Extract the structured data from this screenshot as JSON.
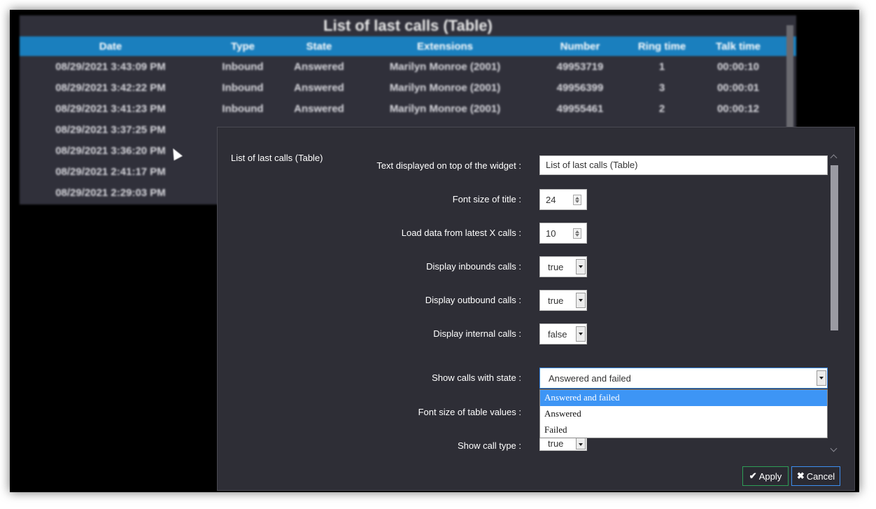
{
  "background_widget": {
    "title": "List of last calls (Table)",
    "columns": [
      "Date",
      "Type",
      "State",
      "Extensions",
      "Number",
      "Ring time",
      "Talk time"
    ],
    "rows": [
      [
        "08/29/2021 3:43:09 PM",
        "Inbound",
        "Answered",
        "Marilyn Monroe (2001)",
        "49953719",
        "1",
        "00:00:10"
      ],
      [
        "08/29/2021 3:42:22 PM",
        "Inbound",
        "Answered",
        "Marilyn Monroe (2001)",
        "49956399",
        "3",
        "00:00:01"
      ],
      [
        "08/29/2021 3:41:23 PM",
        "Inbound",
        "Answered",
        "Marilyn Monroe (2001)",
        "49955461",
        "2",
        "00:00:12"
      ],
      [
        "08/29/2021 3:37:25 PM",
        "",
        "",
        "",
        "",
        "",
        ""
      ],
      [
        "08/29/2021 3:36:20 PM",
        "",
        "",
        "",
        "",
        "",
        ""
      ],
      [
        "08/29/2021 2:41:17 PM",
        "",
        "",
        "",
        "",
        "",
        ""
      ],
      [
        "08/29/2021 2:29:03 PM",
        "",
        "",
        "",
        "",
        "",
        ""
      ]
    ]
  },
  "dialog": {
    "heading": "List of last calls (Table)",
    "fields": {
      "title_text": {
        "label": "Text displayed on top of the widget :",
        "value": "List of last calls (Table)"
      },
      "title_font_size": {
        "label": "Font size of title :",
        "value": "24"
      },
      "latest_calls": {
        "label": "Load data from latest X calls :",
        "value": "10"
      },
      "inbound": {
        "label": "Display inbounds calls :",
        "value": "true"
      },
      "outbound": {
        "label": "Display outbound calls :",
        "value": "true"
      },
      "internal": {
        "label": "Display internal calls :",
        "value": "false"
      },
      "state": {
        "label": "Show calls with state :",
        "value": "Answered and failed"
      },
      "table_font_size": {
        "label": "Font size of table values :"
      },
      "call_type": {
        "label": "Show call type :",
        "value": "true"
      }
    },
    "state_options": [
      "Answered and failed",
      "Answered",
      "Failed"
    ],
    "selected_option_index": 0,
    "apply_label": "Apply",
    "cancel_label": "Cancel",
    "apply_icon": "check-icon",
    "cancel_icon": "x-icon"
  },
  "colors": {
    "header_blue": "#1a7fbe",
    "dialog_bg": "#2e2e36",
    "selected_option": "#3d95f5",
    "apply_border": "#2e9d57",
    "cancel_border": "#3d8ef0"
  }
}
